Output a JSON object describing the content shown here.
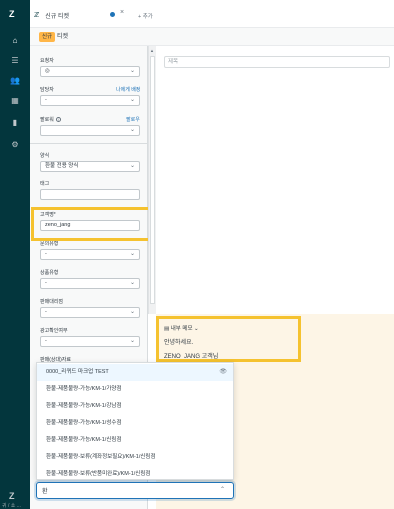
{
  "app": {
    "rail_logo": "Z",
    "rail_footer": "Z",
    "rail_caption": "귀 / 쇼 ..."
  },
  "rail_icons": [
    "home-icon",
    "views-icon",
    "customers-icon",
    "organizations-icon",
    "reporting-icon",
    "admin-icon"
  ],
  "tabs": [
    {
      "title": "신규 티켓",
      "close": "×"
    }
  ],
  "add_tab_label": "+ 추가",
  "subheader": {
    "status_badge": "신규",
    "label": "티켓"
  },
  "form": {
    "requester_label": "요청자",
    "assignee_label": "담당자",
    "assignee_link": "나에게 배정",
    "assignee_value": "-",
    "followers_label": "팔로워",
    "followers_link": "팔로우",
    "form_label": "양식",
    "form_value": "환불 전용 양식",
    "tags_label": "태그",
    "customer_name_label": "고객명*",
    "customer_name_value": "zeno_jang",
    "inquiry_type_label": "문의유형",
    "inquiry_type_value": "-",
    "product_type_label": "상품유형",
    "product_type_value": "-",
    "seller_label": "판매대리점",
    "seller_value": "-",
    "ad_check_label": "광고확인여부",
    "ad_check_value": "-",
    "seller_inquiry_label": "판매(상대)자료"
  },
  "subject_placeholder": "제목",
  "note": {
    "header": "내부 메모",
    "line1": "안녕하세요.",
    "line2": "ZENO_JANG 고객님"
  },
  "dropdown_items": [
    "0000_리퀴드 마크업 TEST",
    "환불-제품불량-가능/KM-1/가양점",
    "환불-제품불량-가능/KM-1/강남점",
    "환불-제품불량-가능/KM-1/성수점",
    "환불-제품불량-가능/KM-1/신림점",
    "환불-제품불량-보류(계좌정보필요)/KM-1/신림점",
    "환불-제품불량-보류(반품미완료)/KM-1/신림점"
  ],
  "macro_input_value": "환"
}
